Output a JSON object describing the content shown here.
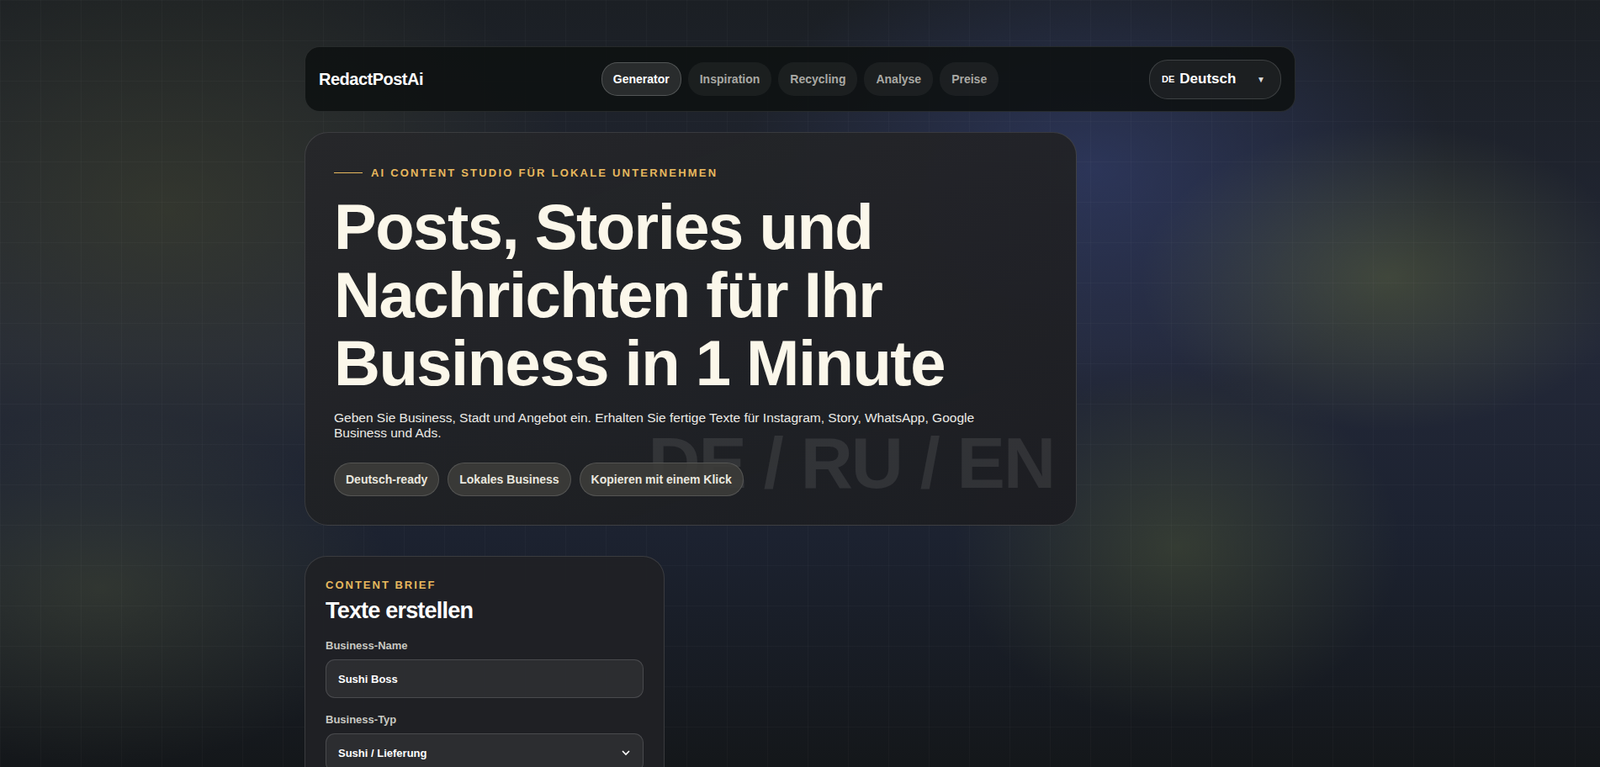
{
  "nav": {
    "logo": "RedactPostAi",
    "tabs": [
      {
        "label": "Generator",
        "selected": true
      },
      {
        "label": "Inspiration",
        "selected": false
      },
      {
        "label": "Recycling",
        "selected": false
      },
      {
        "label": "Analyse",
        "selected": false
      },
      {
        "label": "Preise",
        "selected": false
      }
    ],
    "language": {
      "code": "DE",
      "label": "Deutsch",
      "arrow": "▼"
    }
  },
  "hero": {
    "eyebrow": "AI CONTENT STUDIO FÜR LOKALE UNTERNEHMEN",
    "title_lines": [
      "Posts, Stories und",
      "Nachrichten für Ihr",
      "Business in 1 Minute"
    ],
    "subtitle": "Geben Sie Business, Stadt und Angebot ein. Erhalten Sie fertige Texte für Instagram, Story, WhatsApp, Google Business und Ads.",
    "chips": [
      "Deutsch-ready",
      "Lokales Business",
      "Kopieren mit einem Klick"
    ],
    "watermark": "DE / RU / EN"
  },
  "form": {
    "eyebrow": "CONTENT BRIEF",
    "title": "Texte erstellen",
    "fields": [
      {
        "label": "Business-Name",
        "kind": "input",
        "value": "Sushi Boss"
      },
      {
        "label": "Business-Typ",
        "kind": "select",
        "value": "Sushi / Lieferung"
      }
    ]
  }
}
